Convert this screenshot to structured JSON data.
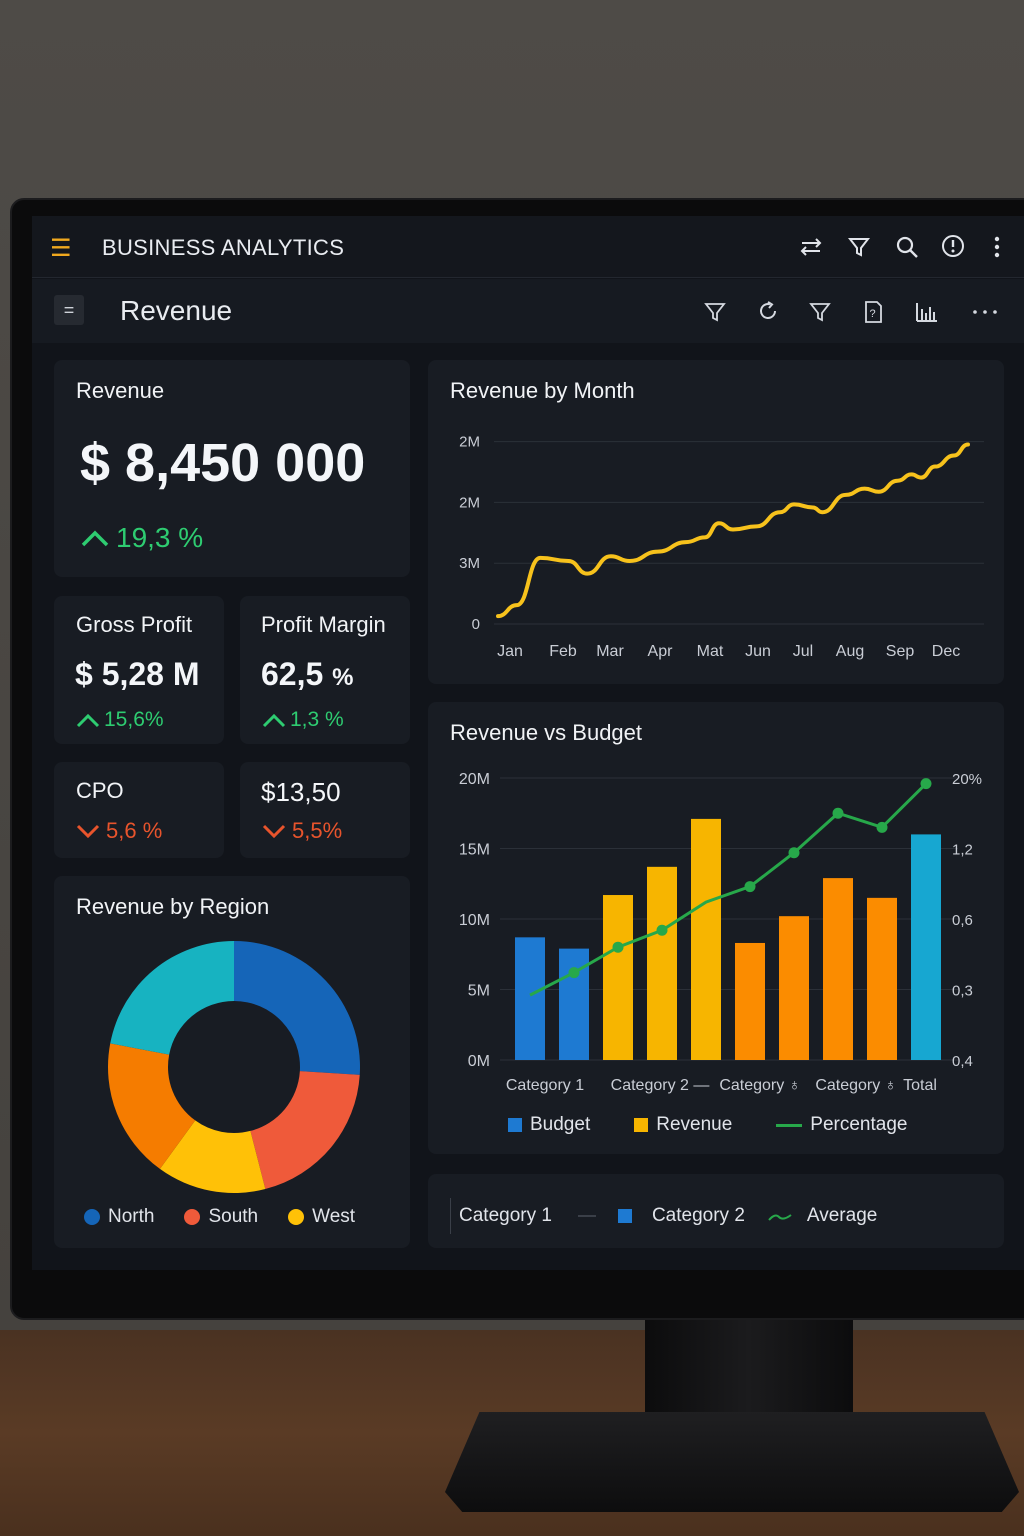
{
  "app": {
    "title": "BUSINESS ANALYTICS"
  },
  "toolbar": {
    "page_title": "Revenue"
  },
  "kpi_revenue": {
    "label": "Revenue",
    "value": "$ 8,450 000",
    "delta": "19,3 %",
    "trend": "up"
  },
  "kpi_gross_profit": {
    "label": "Gross Profit",
    "value": "$ 5,28 M",
    "delta": "15,6%",
    "trend": "up"
  },
  "kpi_profit_margin": {
    "label": "Profit Margin",
    "value": "62,5",
    "unit": "%",
    "delta": "1,3 %",
    "trend": "up"
  },
  "kpi_cpo": {
    "label": "CPO",
    "delta": "5,6 %",
    "trend": "down"
  },
  "kpi_price": {
    "value": "$13,50",
    "delta": "5,5%",
    "trend": "down"
  },
  "region": {
    "title": "Revenue by Region",
    "legend": [
      {
        "label": "North",
        "color": "#1565b8"
      },
      {
        "label": "South",
        "color": "#ef5a3a"
      },
      {
        "label": "West",
        "color": "#ffc107"
      }
    ]
  },
  "month": {
    "title": "Revenue by Month"
  },
  "budget": {
    "title": "Revenue vs Budget",
    "legend": [
      {
        "label": "Budget",
        "color": "#1e7ad2",
        "shape": "square"
      },
      {
        "label": "Revenue",
        "color": "#f7b500",
        "shape": "square"
      },
      {
        "label": "Percentage",
        "color": "#27a84a",
        "shape": "line"
      }
    ]
  },
  "bottom_legend": {
    "items": [
      {
        "label": "Category 1",
        "marker": "line-gray"
      },
      {
        "label": "Category 2",
        "marker": "square-blue"
      },
      {
        "label": "Average",
        "marker": "line-green"
      }
    ]
  },
  "icons": {
    "appbar": [
      "menu-icon",
      "sort-icon",
      "filter-icon",
      "search-icon",
      "help-icon",
      "more-vertical-icon"
    ],
    "subbar": [
      "filter-icon",
      "refresh-icon",
      "filter-icon",
      "report-icon",
      "bar-chart-icon",
      "more-horizontal-icon"
    ]
  },
  "chart_data": [
    {
      "type": "pie",
      "title": "Revenue by Region",
      "style": "donut",
      "slices": [
        {
          "color": "#1565b8",
          "value": 26
        },
        {
          "color": "#ef5a3a",
          "value": 20
        },
        {
          "color": "#ffc107",
          "value": 14
        },
        {
          "color": "#f57c00",
          "value": 18
        },
        {
          "color": "#17b3c1",
          "value": 22
        }
      ],
      "legend": [
        "North",
        "South",
        "West"
      ]
    },
    {
      "type": "line",
      "title": "Revenue by Month",
      "categories": [
        "Jan",
        "Feb",
        "Mar",
        "Apr",
        "Mat",
        "Jun",
        "Jul",
        "Aug",
        "Sep",
        "Dec"
      ],
      "y_tick_labels": [
        "0",
        "3M",
        "2M",
        "2M"
      ],
      "color": "#f7c21c",
      "curve": [
        [
          0.0,
          0.05
        ],
        [
          0.04,
          0.12
        ],
        [
          0.09,
          0.42
        ],
        [
          0.15,
          0.4
        ],
        [
          0.19,
          0.32
        ],
        [
          0.24,
          0.43
        ],
        [
          0.28,
          0.4
        ],
        [
          0.34,
          0.46
        ],
        [
          0.4,
          0.52
        ],
        [
          0.44,
          0.55
        ],
        [
          0.47,
          0.64
        ],
        [
          0.5,
          0.6
        ],
        [
          0.55,
          0.62
        ],
        [
          0.6,
          0.71
        ],
        [
          0.63,
          0.76
        ],
        [
          0.67,
          0.74
        ],
        [
          0.69,
          0.71
        ],
        [
          0.74,
          0.82
        ],
        [
          0.78,
          0.86
        ],
        [
          0.81,
          0.84
        ],
        [
          0.85,
          0.91
        ],
        [
          0.88,
          0.95
        ],
        [
          0.9,
          0.93
        ],
        [
          0.93,
          1.0
        ],
        [
          0.97,
          1.07
        ],
        [
          1.0,
          1.14
        ]
      ]
    },
    {
      "type": "bar",
      "title": "Revenue vs Budget",
      "categories": [
        "Category 1",
        "Category 2 —",
        "Category ♁",
        "Category ♁",
        "Total"
      ],
      "ylim": [
        0,
        20
      ],
      "y_tick_labels": [
        "0M",
        "5M",
        "10M",
        "15M",
        "20M"
      ],
      "y2_tick_labels": [
        "0,4",
        "0,3",
        "0,6",
        "1,2",
        "20%"
      ],
      "bars": [
        {
          "value": 8.7,
          "color": "#1e7ad2"
        },
        {
          "value": 7.9,
          "color": "#1e7ad2"
        },
        {
          "value": 11.7,
          "color": "#f7b500"
        },
        {
          "value": 13.7,
          "color": "#f7b500"
        },
        {
          "value": 17.1,
          "color": "#f7b500"
        },
        {
          "value": 8.3,
          "color": "#fb8c00"
        },
        {
          "value": 10.2,
          "color": "#fb8c00"
        },
        {
          "value": 12.9,
          "color": "#fb8c00"
        },
        {
          "value": 11.5,
          "color": "#fb8c00"
        },
        {
          "value": 16.0,
          "color": "#17a7d1"
        }
      ],
      "line": {
        "name": "Percentage",
        "color": "#27a84a",
        "values": [
          4.6,
          6.2,
          8.0,
          9.2,
          11.2,
          12.3,
          14.7,
          17.5,
          16.5,
          19.6
        ]
      }
    }
  ]
}
